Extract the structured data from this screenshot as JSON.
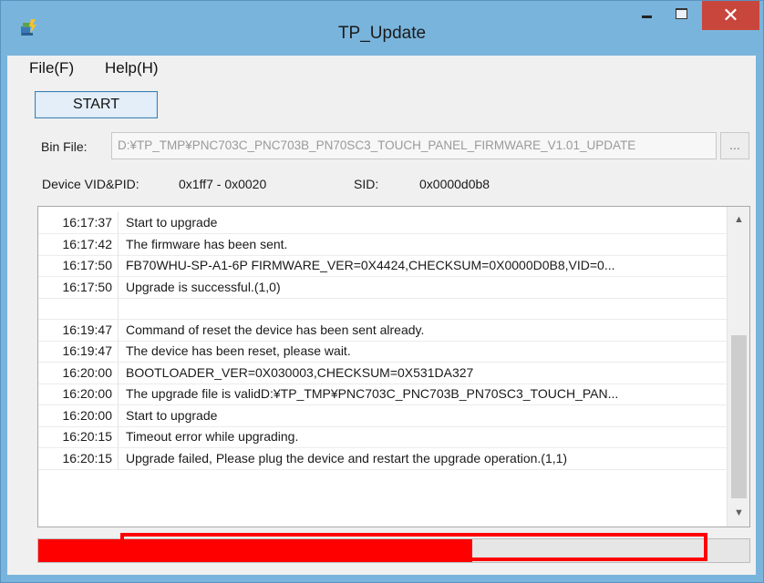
{
  "window": {
    "title": "TP_Update",
    "close_glyph": "✕"
  },
  "menu": {
    "items": [
      "File(F)",
      "Help(H)"
    ]
  },
  "toolbar": {
    "start_label": "START"
  },
  "bin_file": {
    "label": "Bin File:",
    "value": "D:¥TP_TMP¥PNC703C_PNC703B_PN70SC3_TOUCH_PANEL_FIRMWARE_V1.01_UPDATE",
    "browse_label": "..."
  },
  "device": {
    "vid_pid_label": "Device VID&PID:",
    "vid_pid_value": "0x1ff7 - 0x0020",
    "sid_label": "SID:",
    "sid_value": "0x0000d0b8"
  },
  "log": {
    "rows": [
      {
        "time": "16:17:37",
        "message": "Start to upgrade"
      },
      {
        "time": "16:17:42",
        "message": "The firmware has been sent."
      },
      {
        "time": "16:17:50",
        "message": "FB70WHU-SP-A1-6P FIRMWARE_VER=0X4424,CHECKSUM=0X0000D0B8,VID=0..."
      },
      {
        "time": "16:17:50",
        "message": "Upgrade is successful.(1,0)"
      },
      {
        "time": "",
        "message": ""
      },
      {
        "time": "16:19:47",
        "message": "Command of reset the device has been sent already."
      },
      {
        "time": "16:19:47",
        "message": "The device has been reset, please wait."
      },
      {
        "time": "16:20:00",
        "message": "BOOTLOADER_VER=0X030003,CHECKSUM=0X531DA327"
      },
      {
        "time": "16:20:00",
        "message": "The upgrade file is validD:¥TP_TMP¥PNC703C_PNC703B_PN70SC3_TOUCH_PAN..."
      },
      {
        "time": "16:20:00",
        "message": "Start to upgrade"
      },
      {
        "time": "16:20:15",
        "message": "Timeout error while upgrading."
      },
      {
        "time": "16:20:15",
        "message": "Upgrade failed, Please plug the device and restart the upgrade operation.(1,1)"
      }
    ]
  },
  "progress": {
    "fraction": 0.61,
    "color": "#ff0000"
  },
  "colors": {
    "title_bar": "#79b4dc",
    "close_button": "#c9463d",
    "highlight": "#ff0000"
  },
  "icons": {
    "app": "app-icon",
    "minimize": "minimize-icon",
    "maximize": "maximize-icon",
    "close": "close-icon",
    "scroll_up": "scroll-up-icon",
    "scroll_down": "scroll-down-icon"
  }
}
